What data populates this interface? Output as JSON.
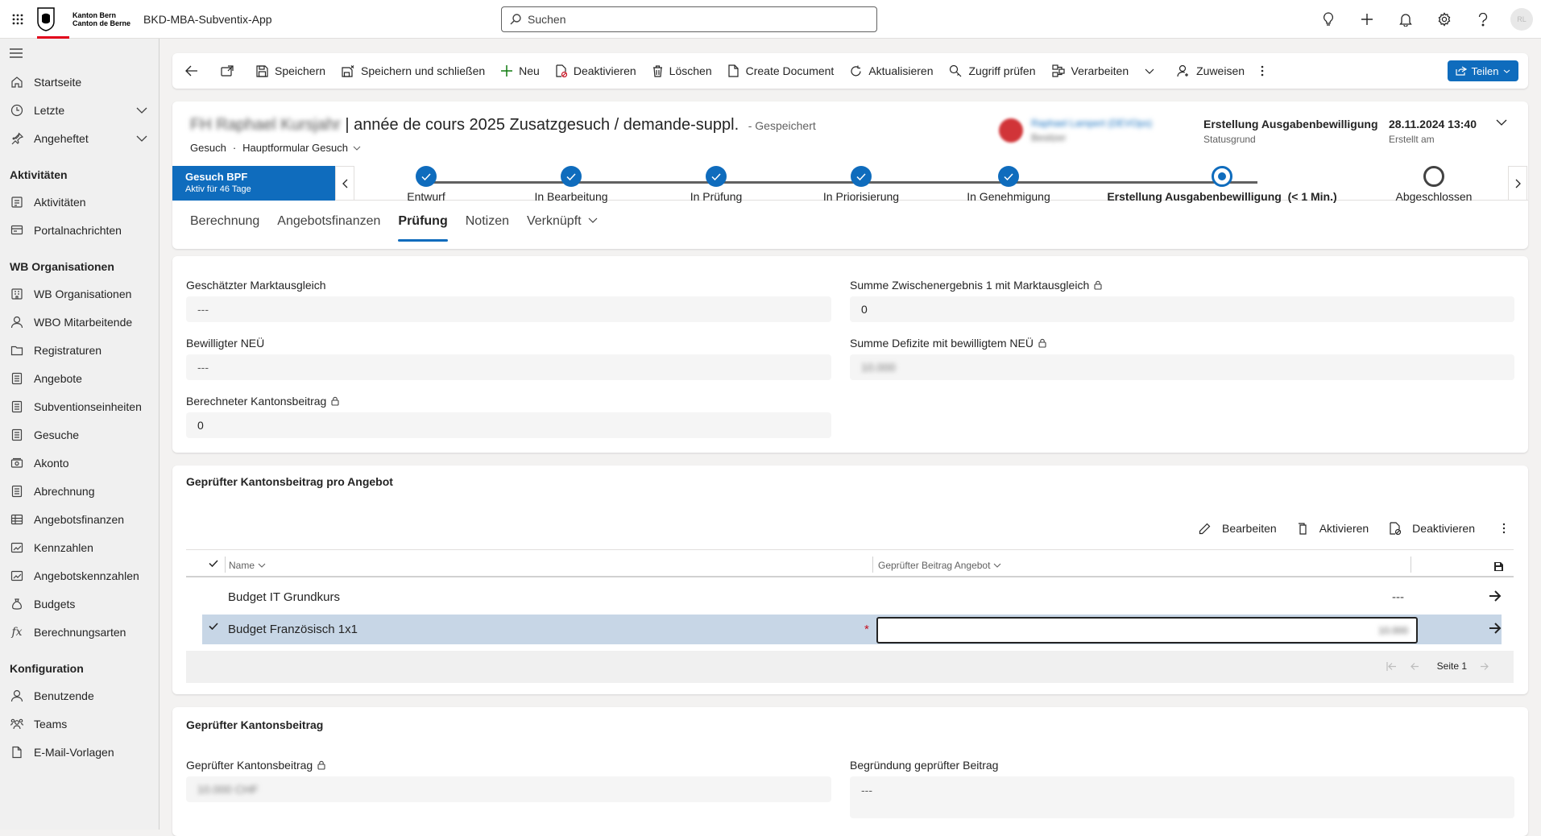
{
  "topbar": {
    "logo_line1": "Kanton Bern",
    "logo_line2": "Canton de Berne",
    "app_title": "BKD-MBA-Subventix-App",
    "search_placeholder": "Suchen",
    "avatar_initials": "RL"
  },
  "sidebar": {
    "items_top": [
      {
        "label": "Startseite",
        "icon": "home-icon"
      },
      {
        "label": "Letzte",
        "icon": "clock-icon"
      },
      {
        "label": "Angeheftet",
        "icon": "pin-icon"
      }
    ],
    "groups": [
      {
        "title": "Aktivitäten",
        "items": [
          {
            "label": "Aktivitäten"
          },
          {
            "label": "Portalnachrichten"
          }
        ]
      },
      {
        "title": "WB Organisationen",
        "items": [
          {
            "label": "WB Organisationen"
          },
          {
            "label": "WBO Mitarbeitende"
          },
          {
            "label": "Registraturen"
          },
          {
            "label": "Angebote"
          },
          {
            "label": "Subventionseinheiten"
          },
          {
            "label": "Gesuche"
          },
          {
            "label": "Akonto"
          },
          {
            "label": "Abrechnung"
          },
          {
            "label": "Angebotsfinanzen"
          },
          {
            "label": "Kennzahlen"
          },
          {
            "label": "Angebotskennzahlen"
          },
          {
            "label": "Budgets"
          },
          {
            "label": "Berechnungsarten"
          }
        ]
      },
      {
        "title": "Konfiguration",
        "items": [
          {
            "label": "Benutzende"
          },
          {
            "label": "Teams"
          },
          {
            "label": "E-Mail-Vorlagen"
          }
        ]
      }
    ]
  },
  "commandbar": {
    "save": "Speichern",
    "save_close": "Speichern und schließen",
    "new": "Neu",
    "deactivate": "Deaktivieren",
    "delete": "Löschen",
    "create_document": "Create Document",
    "refresh": "Aktualisieren",
    "check_access": "Zugriff prüfen",
    "process": "Verarbeiten",
    "assign": "Zuweisen",
    "share": "Teilen"
  },
  "header": {
    "title_blurred": "FH Raphael Kursjahr",
    "title": "| année de cours 2025 Zusatzgesuch / demande-suppl.",
    "saved_status": "- Gespeichert",
    "entity": "Gesuch",
    "form": "Hauptformular Gesuch",
    "owner_name": "Raphael Lampert (DEVOps)",
    "owner_role": "Besitzer",
    "status_value": "Erstellung Ausgabenbewilligung",
    "status_label": "Statusgrund",
    "created_value": "28.11.2024 13:40",
    "created_label": "Erstellt am"
  },
  "bpf": {
    "name": "Gesuch BPF",
    "duration": "Aktiv für 46 Tage",
    "stages": [
      {
        "label": "Entwurf",
        "state": "done"
      },
      {
        "label": "In Bearbeitung",
        "state": "done"
      },
      {
        "label": "In Prüfung",
        "state": "done"
      },
      {
        "label": "In Priorisierung",
        "state": "done"
      },
      {
        "label": "In Genehmigung",
        "state": "done"
      },
      {
        "label": "Erstellung Ausgabenbewilligung  (< 1 Min.)",
        "state": "active"
      },
      {
        "label": "Abgeschlossen",
        "state": "todo"
      }
    ]
  },
  "tabs": [
    "Berechnung",
    "Angebotsfinanzen",
    "Prüfung",
    "Notizen",
    "Verknüpft"
  ],
  "section1": {
    "f1_label": "Geschätzter Marktausgleich",
    "f1_value": "---",
    "f2_label": "Summe Zwischenergebnis 1 mit Marktausgleich",
    "f2_value": "0",
    "f3_label": "Bewilligter NEÜ",
    "f3_value": "---",
    "f4_label": "Summe Defizite mit bewilligtem NEÜ",
    "f4_value": "10.000",
    "f5_label": "Berechneter Kantonsbeitrag",
    "f5_value": "0"
  },
  "subgrid": {
    "title": "Geprüfter Kantonsbeitrag pro Angebot",
    "edit": "Bearbeiten",
    "activate": "Aktivieren",
    "deactivate": "Deaktivieren",
    "col_name": "Name",
    "col_amount": "Geprüfter Beitrag Angebot",
    "rows": [
      {
        "name": "Budget IT Grundkurs",
        "amount": "---"
      },
      {
        "name": "Budget Französisch 1x1",
        "amount": "10.000"
      }
    ],
    "page": "Seite 1"
  },
  "section3": {
    "title": "Geprüfter Kantonsbeitrag",
    "f1_label": "Geprüfter Kantonsbeitrag",
    "f1_value": "10.000 CHF",
    "f2_label": "Begründung geprüfter Beitrag",
    "f2_value": "---"
  },
  "colors": {
    "accent": "#0f6cbd",
    "selected_row": "#c7d6e6",
    "required": "#c50f1f"
  }
}
